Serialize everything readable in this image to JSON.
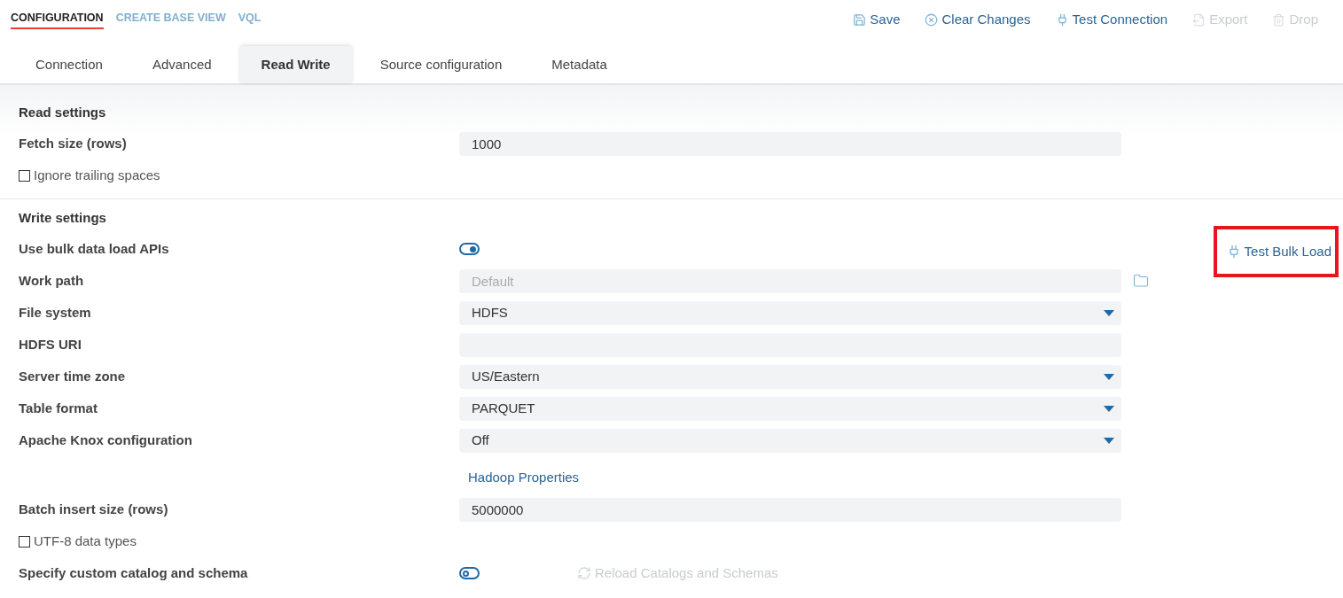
{
  "top_nav": [
    {
      "label": "CONFIGURATION",
      "selected": true
    },
    {
      "label": "CREATE BASE VIEW",
      "selected": false
    },
    {
      "label": "VQL",
      "selected": false
    }
  ],
  "toolbar": [
    {
      "label": "Save",
      "disabled": false
    },
    {
      "label": "Clear Changes",
      "disabled": false
    },
    {
      "label": "Test Connection",
      "disabled": false
    },
    {
      "label": "Export",
      "disabled": true
    },
    {
      "label": "Drop",
      "disabled": true
    }
  ],
  "tabs": [
    {
      "label": "Connection",
      "selected": false
    },
    {
      "label": "Advanced",
      "selected": false
    },
    {
      "label": "Read Write",
      "selected": true
    },
    {
      "label": "Source configuration",
      "selected": false
    },
    {
      "label": "Metadata",
      "selected": false
    }
  ],
  "sections": [
    {
      "title": "Read settings",
      "rows": [
        {
          "kind": "input",
          "label": "Fetch size (rows)",
          "value": "1000"
        },
        {
          "kind": "checkbox",
          "label": "Ignore trailing spaces",
          "checked": false
        }
      ]
    },
    {
      "title": "Write settings",
      "rows": [
        {
          "kind": "toggle",
          "label": "Use bulk data load APIs",
          "on": true,
          "action": {
            "kind": "side",
            "label": "Test Bulk Load",
            "disabled": false,
            "highlighted": true
          }
        },
        {
          "kind": "input",
          "label": "Work path",
          "placeholder": "Default",
          "browse": true
        },
        {
          "kind": "select",
          "label": "File system",
          "value": "HDFS"
        },
        {
          "kind": "input",
          "label": "HDFS URI"
        },
        {
          "kind": "select",
          "label": "Server time zone",
          "value": "US/Eastern"
        },
        {
          "kind": "select",
          "label": "Table format",
          "value": "PARQUET"
        },
        {
          "kind": "select",
          "label": "Apache Knox configuration",
          "value": "Off"
        },
        {
          "kind": "link",
          "label": "Hadoop Properties"
        },
        {
          "kind": "input",
          "label": "Batch insert size (rows)",
          "value": "5000000"
        },
        {
          "kind": "checkbox",
          "label": "UTF-8 data types",
          "checked": false
        },
        {
          "kind": "toggle",
          "label": "Specify custom catalog and schema",
          "on": false,
          "action": {
            "kind": "inline",
            "label": "Reload Catalogs and Schemas",
            "disabled": true
          }
        }
      ]
    }
  ]
}
